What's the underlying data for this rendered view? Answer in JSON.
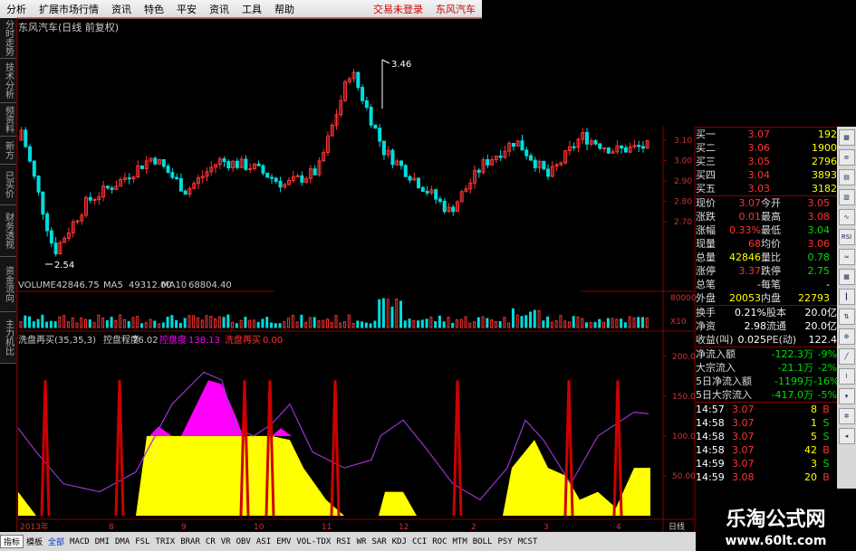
{
  "menu": {
    "items": [
      "分析",
      "扩展市场行情",
      "资讯",
      "特色",
      "平安",
      "资讯",
      "工具",
      "帮助"
    ],
    "login": "交易未登录",
    "stock": "东风汽车"
  },
  "left_tabs": [
    "分时走势",
    "技术分析",
    "频资料",
    "新方",
    "已买价",
    "财务透视",
    "资金流向",
    "主力机比"
  ],
  "stock_title": "东风汽车(日线 前复权)",
  "price_labels": {
    "high": "3.46",
    "low": "2.54",
    "axis": [
      "3.10",
      "3.00",
      "2.90",
      "2.80",
      "2.70"
    ]
  },
  "volume": {
    "label": "VOLUME",
    "value": "42846.75",
    "ma5_label": "MA5",
    "ma5": "49312.00",
    "ma10_label": "MA10",
    "ma10": "68804.40",
    "axis_top": "80000",
    "axis_unit": "X10"
  },
  "indicator": {
    "name": "洗盘再买(35,35,3)",
    "k1_label": "控盘程度",
    "k1_value": "76.02",
    "k2_label": "控盘度",
    "k2_value": "138.13",
    "k3_label": "洗盘再买",
    "k3_value": "0.00",
    "axis": [
      "200.0",
      "150.0",
      "100.0",
      "50.00"
    ]
  },
  "x_axis": [
    "2013年",
    "8",
    "9",
    "10",
    "11",
    "12",
    "2",
    "3",
    "4"
  ],
  "x_unit": "日线",
  "quote": {
    "bids": [
      {
        "label": "买一",
        "price": "3.07",
        "vol": "192"
      },
      {
        "label": "买二",
        "price": "3.06",
        "vol": "1900"
      },
      {
        "label": "买三",
        "price": "3.05",
        "vol": "2796"
      },
      {
        "label": "买四",
        "price": "3.04",
        "vol": "3893"
      },
      {
        "label": "买五",
        "price": "3.03",
        "vol": "3182"
      }
    ],
    "stats": [
      {
        "l1": "现价",
        "v1": "3.07",
        "l2": "今开",
        "v2": "3.05"
      },
      {
        "l1": "涨跌",
        "v1": "0.01",
        "l2": "最高",
        "v2": "3.08"
      },
      {
        "l1": "涨幅",
        "v1": "0.33%",
        "l2": "最低",
        "v2": "3.04"
      },
      {
        "l1": "现量",
        "v1": "68",
        "l2": "均价",
        "v2": "3.06"
      },
      {
        "l1": "总量",
        "v1": "42846",
        "l2": "量比",
        "v2": "0.78"
      },
      {
        "l1": "涨停",
        "v1": "3.37",
        "l2": "跌停",
        "v2": "2.75"
      },
      {
        "l1": "总笔",
        "v1": "-",
        "l2": "每笔",
        "v2": "-"
      },
      {
        "l1": "外盘",
        "v1": "20053",
        "l2": "内盘",
        "v2": "22793"
      }
    ],
    "stats2": [
      {
        "l1": "换手",
        "v1": "0.21%",
        "l2": "股本",
        "v2": "20.0亿"
      },
      {
        "l1": "净资",
        "v1": "2.98",
        "l2": "流通",
        "v2": "20.0亿"
      },
      {
        "l1": "收益(叫)",
        "v1": "0.025",
        "l2": "PE(动)",
        "v2": "122.4"
      }
    ],
    "flows": [
      {
        "label": "净流入额",
        "value": "-122.3万",
        "pct": "-9%"
      },
      {
        "label": "大宗流入",
        "value": "-21.1万",
        "pct": "-2%"
      },
      {
        "label": "5日净流入额",
        "value": "-1199万",
        "pct": "-16%"
      },
      {
        "label": "5日大宗流入",
        "value": "-417.0万",
        "pct": "-5%"
      }
    ],
    "ticks": [
      {
        "time": "14:57",
        "price": "3.07",
        "vol": "8",
        "side": "B"
      },
      {
        "time": "14:58",
        "price": "3.07",
        "vol": "1",
        "side": "S"
      },
      {
        "time": "14:58",
        "price": "3.07",
        "vol": "5",
        "side": "S"
      },
      {
        "time": "14:58",
        "price": "3.07",
        "vol": "42",
        "side": "B"
      },
      {
        "time": "14:59",
        "price": "3.07",
        "vol": "3",
        "side": "S"
      },
      {
        "time": "14:59",
        "price": "3.08",
        "vol": "20",
        "side": "B"
      }
    ]
  },
  "bottom_tabs": [
    "指标",
    "模板",
    "全部",
    "MACD",
    "DMI",
    "DMA",
    "FSL",
    "TRIX",
    "BRAR",
    "CR",
    "VR",
    "OBV",
    "ASI",
    "EMV",
    "VOL-TDX",
    "RSI",
    "WR",
    "SAR",
    "KDJ",
    "CCI",
    "ROC",
    "MTM",
    "BOLL",
    "PSY",
    "MCST"
  ],
  "watermark": {
    "line1": "乐淘公式网",
    "line2": "www.60lt.com"
  },
  "colors": {
    "up": "#ff3333",
    "down": "#00dddd",
    "pink": "#ff00ff",
    "yellow": "#ffff00",
    "redline": "#cc0000",
    "purple": "#9933cc"
  }
}
